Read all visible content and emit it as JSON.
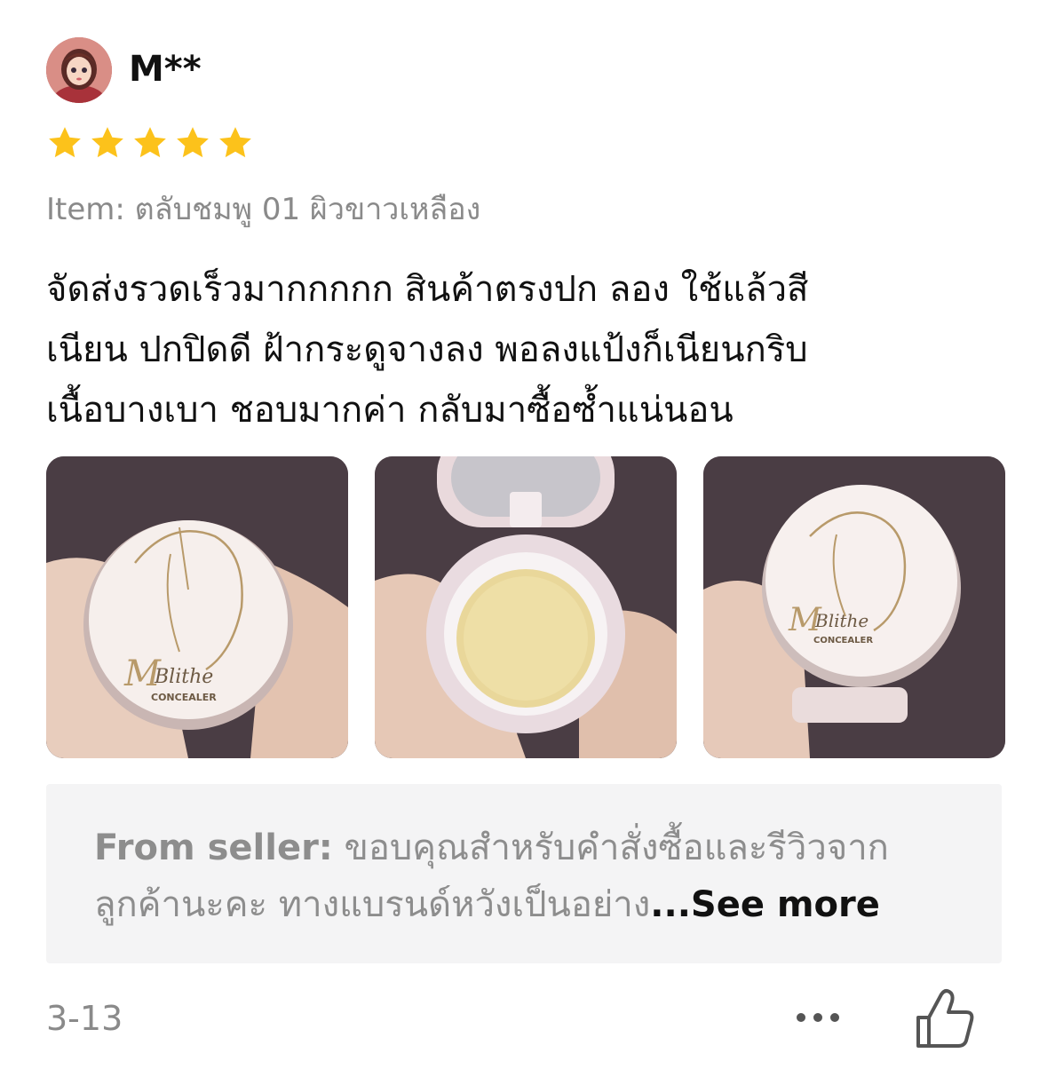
{
  "review": {
    "username": "M**",
    "rating": 5,
    "item_label": "Item: ตลับชมพู 01 ผิวขาวเหลือง",
    "text_lines": [
      "จัดส่งรวดเร็วมากกกกก สินค้าตรงปก ลอง ใช้แล้วสี",
      "เนียน ปกปิดดี ฝ้ากระดูจางลง พอลงแป้งก็เนียนกริบ",
      "เนื้อบางเบา ชอบมากค่า กลับมาซื้อซ้ำแน่นอน"
    ],
    "photos": [
      {
        "brand": "Blithe",
        "subtitle": "CONCEALER"
      },
      {
        "brand": "",
        "subtitle": ""
      },
      {
        "brand": "Blithe",
        "subtitle": "CONCEALER"
      }
    ],
    "star_color": "#FCC21B"
  },
  "seller_reply": {
    "label": "From seller:",
    "line1": " ขอบคุณสำหรับคำสั่งซื้อและรีวิวจาก",
    "line2": "ลูกค้านะคะ ทางแบรนด์หวังเป็นอย่าง",
    "see_more": "...See more"
  },
  "footer": {
    "date": "3-13",
    "more_icon": "more-dots-icon",
    "like_icon": "thumbs-up-icon"
  }
}
